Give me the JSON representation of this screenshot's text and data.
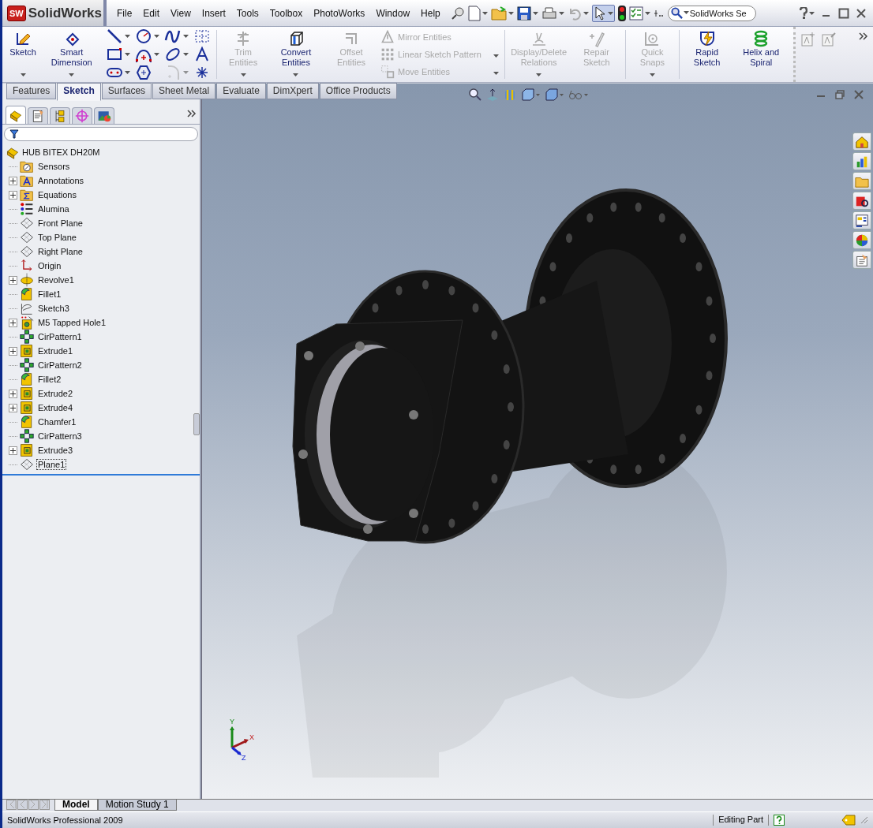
{
  "app": {
    "badge": "SW",
    "name": "SolidWorks"
  },
  "menu": [
    "File",
    "Edit",
    "View",
    "Insert",
    "Tools",
    "Toolbox",
    "PhotoWorks",
    "Window",
    "Help"
  ],
  "search": {
    "placeholder": "SolidWorks Se"
  },
  "ribbon": [
    {
      "buttons": [
        {
          "label": "Sketch",
          "kind": "sketch",
          "disabled": false,
          "dropdown": true
        },
        {
          "label": "Smart Dimension",
          "kind": "dimension",
          "disabled": false,
          "dropdown": true
        },
        {
          "kind": "tools",
          "tools": [
            {
              "kind": "line",
              "dropdown": true,
              "disabled": false
            },
            {
              "kind": "circle",
              "dropdown": true,
              "disabled": false
            },
            {
              "kind": "spline",
              "dropdown": true,
              "disabled": false
            },
            {
              "kind": "grid",
              "dropdown": false,
              "disabled": false
            },
            {
              "kind": "rectangle",
              "dropdown": true,
              "disabled": false
            },
            {
              "kind": "arc",
              "dropdown": true,
              "disabled": false
            },
            {
              "kind": "ellipse",
              "dropdown": true,
              "disabled": false
            },
            {
              "kind": "text",
              "dropdown": false,
              "disabled": false
            },
            {
              "kind": "slot",
              "dropdown": true,
              "disabled": false
            },
            {
              "kind": "polygon",
              "dropdown": false,
              "disabled": false
            },
            {
              "kind": "fillet",
              "dropdown": true,
              "disabled": true
            },
            {
              "kind": "point",
              "dropdown": false,
              "disabled": false
            }
          ]
        }
      ]
    },
    {
      "buttons": [
        {
          "label": "Trim Entities",
          "kind": "trim",
          "disabled": true,
          "dropdown": true
        },
        {
          "label": "Convert Entities",
          "kind": "convert",
          "disabled": false,
          "dropdown": true
        },
        {
          "label": "Offset Entities",
          "kind": "offset",
          "disabled": true,
          "dropdown": false
        },
        {
          "kind": "stack",
          "items": [
            {
              "label": "Mirror Entities",
              "kind": "mirror",
              "disabled": true,
              "dropdown": false
            },
            {
              "label": "Linear Sketch Pattern",
              "kind": "pattern",
              "disabled": true,
              "dropdown": true
            },
            {
              "label": "Move Entities",
              "kind": "move",
              "disabled": true,
              "dropdown": true
            }
          ]
        }
      ]
    },
    {
      "buttons": [
        {
          "label": "Display/Delete Relations",
          "kind": "relations",
          "disabled": true,
          "dropdown": true
        },
        {
          "label": "Repair Sketch",
          "kind": "repair",
          "disabled": true,
          "dropdown": false
        }
      ]
    },
    {
      "buttons": [
        {
          "label": "Quick Snaps",
          "kind": "snaps",
          "disabled": true,
          "dropdown": true
        }
      ]
    },
    {
      "buttons": [
        {
          "label": "Rapid Sketch",
          "kind": "rapid",
          "disabled": false,
          "dropdown": false
        },
        {
          "label": "Helix and Spiral",
          "kind": "helix",
          "disabled": false,
          "dropdown": false
        }
      ]
    }
  ],
  "command_tabs": [
    {
      "label": "Features",
      "selected": false
    },
    {
      "label": "Sketch",
      "selected": true
    },
    {
      "label": "Surfaces",
      "selected": false
    },
    {
      "label": "Sheet Metal",
      "selected": false
    },
    {
      "label": "Evaluate",
      "selected": false
    },
    {
      "label": "DimXpert",
      "selected": false
    },
    {
      "label": "Office Products",
      "selected": false
    }
  ],
  "panel_tabs": [
    {
      "kind": "part",
      "selected": true
    },
    {
      "kind": "property",
      "selected": false
    },
    {
      "kind": "config",
      "selected": false
    },
    {
      "kind": "target",
      "selected": false
    },
    {
      "kind": "display",
      "selected": false
    }
  ],
  "tree": {
    "root": "HUB BITEX DH20M",
    "items": [
      {
        "label": "Sensors",
        "kind": "sensors",
        "expander": false,
        "selected": false
      },
      {
        "label": "Annotations",
        "kind": "annotations",
        "expander": true,
        "selected": false
      },
      {
        "label": "Equations",
        "kind": "equations",
        "expander": true,
        "selected": false
      },
      {
        "label": "Alumina",
        "kind": "material",
        "expander": false,
        "selected": false
      },
      {
        "label": "Front Plane",
        "kind": "plane",
        "expander": false,
        "selected": false
      },
      {
        "label": "Top Plane",
        "kind": "plane",
        "expander": false,
        "selected": false
      },
      {
        "label": "Right Plane",
        "kind": "plane",
        "expander": false,
        "selected": false
      },
      {
        "label": "Origin",
        "kind": "origin",
        "expander": false,
        "selected": false
      },
      {
        "label": "Revolve1",
        "kind": "revolve",
        "expander": true,
        "selected": false
      },
      {
        "label": "Fillet1",
        "kind": "fillet",
        "expander": false,
        "selected": false
      },
      {
        "label": "Sketch3",
        "kind": "sketch",
        "expander": false,
        "selected": false
      },
      {
        "label": "M5 Tapped Hole1",
        "kind": "hole",
        "expander": true,
        "selected": false
      },
      {
        "label": "CirPattern1",
        "kind": "cirpattern",
        "expander": false,
        "selected": false
      },
      {
        "label": "Extrude1",
        "kind": "extrude",
        "expander": true,
        "selected": false
      },
      {
        "label": "CirPattern2",
        "kind": "cirpattern",
        "expander": false,
        "selected": false
      },
      {
        "label": "Fillet2",
        "kind": "fillet",
        "expander": false,
        "selected": false
      },
      {
        "label": "Extrude2",
        "kind": "extrude",
        "expander": true,
        "selected": false
      },
      {
        "label": "Extrude4",
        "kind": "extrude",
        "expander": true,
        "selected": false
      },
      {
        "label": "Chamfer1",
        "kind": "fillet",
        "expander": false,
        "selected": false
      },
      {
        "label": "CirPattern3",
        "kind": "cirpattern",
        "expander": false,
        "selected": false
      },
      {
        "label": "Extrude3",
        "kind": "extrude",
        "expander": true,
        "selected": false
      },
      {
        "label": "Plane1",
        "kind": "plane",
        "expander": false,
        "selected": true
      }
    ]
  },
  "triad": {
    "x": "X",
    "y": "Y",
    "z": "Z"
  },
  "bottom_tabs": [
    {
      "label": "Model",
      "selected": true
    },
    {
      "label": "Motion Study 1",
      "selected": false
    }
  ],
  "status_bar": {
    "product": "SolidWorks Professional 2009",
    "mode": "Editing Part"
  }
}
